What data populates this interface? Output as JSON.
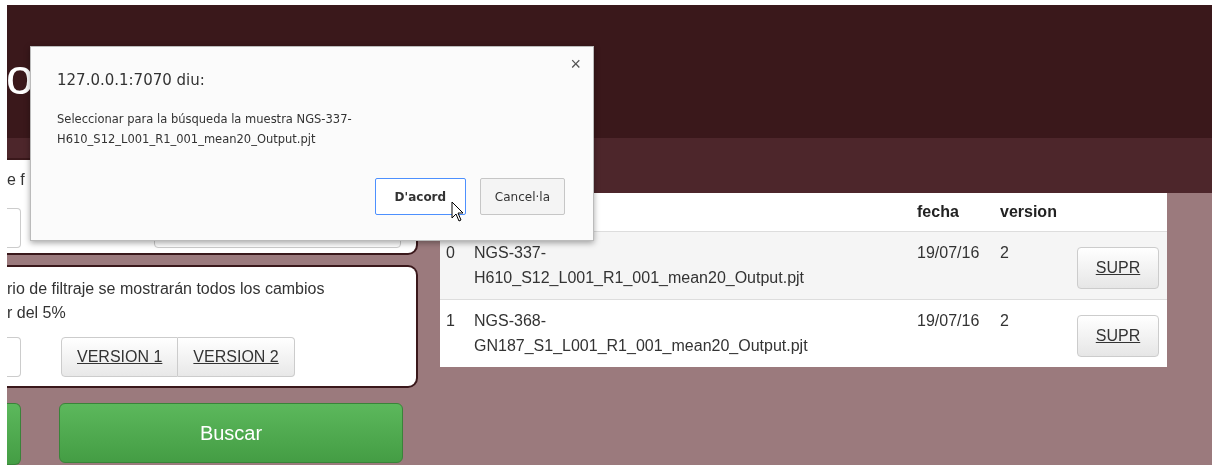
{
  "header": {
    "title": "o"
  },
  "filter_box": {
    "label": "e f"
  },
  "version_box": {
    "lines": [
      "rio de filtraje se mostrarán todos los cambios",
      "r del 5%"
    ],
    "buttons": [
      "VERSION 1",
      "VERSION 2"
    ]
  },
  "search_button": "Buscar",
  "table": {
    "columns": [
      "fecha",
      "version"
    ],
    "rows": [
      {
        "index": "0",
        "name_lines": [
          "NGS-337-",
          "H610_S12_L001_R1_001_mean20_Output.pjt"
        ],
        "fecha": "19/07/16",
        "version": "2",
        "action": "SUPR"
      },
      {
        "index": "1",
        "name_lines": [
          "NGS-368-",
          "GN187_S1_L001_R1_001_mean20_Output.pjt"
        ],
        "fecha": "19/07/16",
        "version": "2",
        "action": "SUPR"
      }
    ]
  },
  "dialog": {
    "title": "127.0.0.1:7070 diu:",
    "message_lines": [
      "Seleccionar para la búsqueda la muestra NGS-337-",
      "H610_S12_L001_R1_001_mean20_Output.pjt"
    ],
    "close": "×",
    "buttons": [
      {
        "label": "D'acord",
        "focused": true
      },
      {
        "label": "Cancel·la",
        "focused": false
      }
    ]
  }
}
